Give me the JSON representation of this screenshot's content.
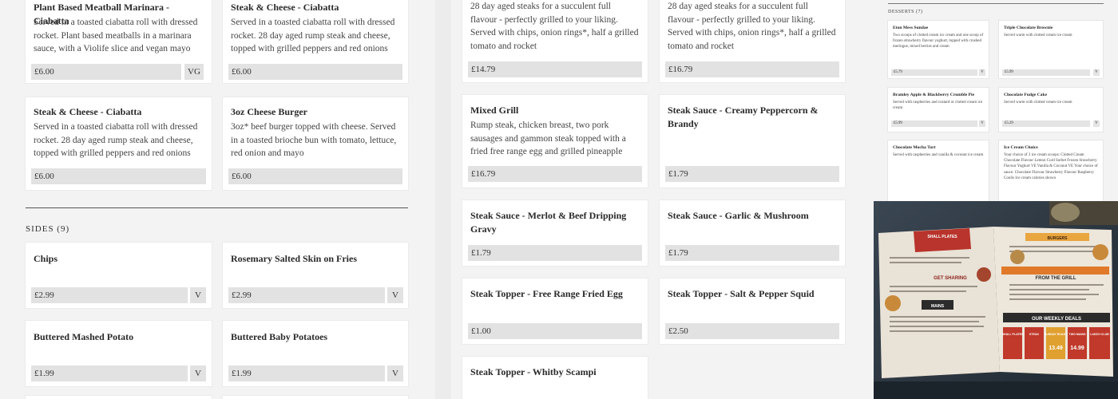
{
  "pane1": {
    "cards": [
      {
        "title": "Plant Based Meatball Marinara - Ciabatta",
        "desc": "Served in a toasted ciabatta roll with dressed rocket. Plant based meatballs in a marinara sauce, with a Violife slice and vegan mayo",
        "price": "£6.00",
        "diet": "VG"
      },
      {
        "title": "Steak & Cheese - Ciabatta",
        "desc": "Served in a toasted ciabatta roll with dressed rocket. 28 day aged rump steak and cheese, topped with grilled peppers and red onions",
        "price": "£6.00",
        "diet": ""
      },
      {
        "title": "Steak & Cheese - Ciabatta",
        "desc": "Served in a toasted ciabatta roll with dressed rocket. 28 day aged rump steak and cheese, topped with grilled peppers and red onions",
        "price": "£6.00",
        "diet": ""
      },
      {
        "title": "3oz Cheese Burger",
        "desc": "3oz* beef burger topped with cheese. Served in a toasted brioche bun with tomato, lettuce, red onion and mayo",
        "price": "£6.00",
        "diet": ""
      }
    ],
    "sides_heading": "SIDES (9)",
    "sides": [
      {
        "title": "Chips",
        "price": "£2.99",
        "diet": "V"
      },
      {
        "title": "Rosemary Salted Skin on Fries",
        "price": "£2.99",
        "diet": "V"
      },
      {
        "title": "Buttered Mashed Potato",
        "price": "£1.99",
        "diet": "V"
      },
      {
        "title": "Buttered Baby Potatoes",
        "price": "£1.99",
        "diet": "V"
      }
    ]
  },
  "pane2": {
    "cards": [
      {
        "title": "",
        "desc": "28 day aged steaks for a succulent full flavour - perfectly grilled to your liking. Served with chips, onion rings*, half a grilled tomato and rocket",
        "price": "£14.79"
      },
      {
        "title": "",
        "desc": "28 day aged steaks for a succulent full flavour - perfectly grilled to your liking. Served with chips, onion rings*, half a grilled tomato and rocket",
        "price": "£16.79"
      },
      {
        "title": "Mixed Grill",
        "desc": "Rump steak, chicken breast, two pork sausages and gammon steak topped with a fried free range egg and grilled pineapple",
        "price": "£16.79"
      },
      {
        "title": "Steak Sauce - Creamy Peppercorn & Brandy",
        "desc": "",
        "price": "£1.79"
      },
      {
        "title": "Steak Sauce - Merlot & Beef Dripping Gravy",
        "desc": "",
        "price": "£1.79"
      },
      {
        "title": "Steak Sauce - Garlic & Mushroom",
        "desc": "",
        "price": "£1.79"
      },
      {
        "title": "Steak Topper - Free Range Fried Egg",
        "desc": "",
        "price": "£1.00"
      },
      {
        "title": "Steak Topper - Salt & Pepper Squid",
        "desc": "",
        "price": "£2.50"
      },
      {
        "title": "Steak Topper - Whitby Scampi",
        "desc": "",
        "price": ""
      }
    ]
  },
  "pane3": {
    "heading": "DESSERTS (7)",
    "cards": [
      {
        "title": "Eton Mess Sundae",
        "desc": "Two scoops of clotted cream ice cream and one scoop of frozen strawberry flavour yoghurt, topped with crushed meringue, mixed berries and cream",
        "price": "£5.79",
        "diet": "V"
      },
      {
        "title": "Triple Chocolate Brownie",
        "desc": "Served warm with clotted cream ice cream",
        "price": "£5.99",
        "diet": "V"
      },
      {
        "title": "Bramley Apple & Blackberry Crumble Pie",
        "desc": "Served with raspberries and custard or clotted cream ice cream",
        "price": "£5.99",
        "diet": "V"
      },
      {
        "title": "Chocolate Fudge Cake",
        "desc": "Served warm with clotted cream ice cream",
        "price": "£5.29",
        "diet": "V"
      },
      {
        "title": "Chocolate Mocha Tart",
        "desc": "Served with raspberries and vanilla & coconut ice cream",
        "price": "",
        "diet": ""
      },
      {
        "title": "Ice Cream Choice",
        "desc": "Your choice of 3 ice cream scoops: Clotted Cream Chocolate Flavour Lemon Curd Sorbet Frozen Strawberry Flavour Yoghurt VE Vanilla & Coconut VE Your choice of sauce: Chocolate Flavour Strawberry Flavour Raspberry Coulis Ice cream calories shown",
        "price": "",
        "diet": ""
      }
    ],
    "photo": {
      "panels": [
        "SHALL PLATES",
        "GET SHARING",
        "MAINS",
        "BURGERS",
        "FROM THE GRILL",
        "OUR WEEKLY DEALS"
      ],
      "deals": [
        "SHALL PLATES",
        "STEAK",
        "SUNDAY ROAST",
        "TWO MAINS",
        "LUNCH CLUB"
      ],
      "prices": [
        "13.49",
        "14.99"
      ]
    }
  }
}
